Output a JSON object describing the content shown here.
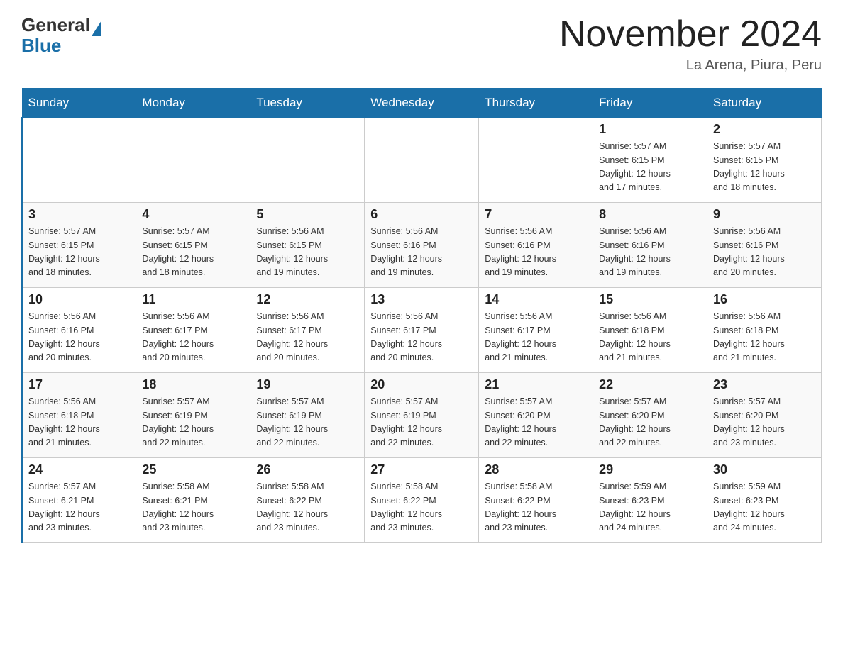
{
  "logo": {
    "text_general": "General",
    "text_blue": "Blue"
  },
  "title": "November 2024",
  "location": "La Arena, Piura, Peru",
  "weekdays": [
    "Sunday",
    "Monday",
    "Tuesday",
    "Wednesday",
    "Thursday",
    "Friday",
    "Saturday"
  ],
  "weeks": [
    [
      {
        "day": "",
        "info": ""
      },
      {
        "day": "",
        "info": ""
      },
      {
        "day": "",
        "info": ""
      },
      {
        "day": "",
        "info": ""
      },
      {
        "day": "",
        "info": ""
      },
      {
        "day": "1",
        "info": "Sunrise: 5:57 AM\nSunset: 6:15 PM\nDaylight: 12 hours\nand 17 minutes."
      },
      {
        "day": "2",
        "info": "Sunrise: 5:57 AM\nSunset: 6:15 PM\nDaylight: 12 hours\nand 18 minutes."
      }
    ],
    [
      {
        "day": "3",
        "info": "Sunrise: 5:57 AM\nSunset: 6:15 PM\nDaylight: 12 hours\nand 18 minutes."
      },
      {
        "day": "4",
        "info": "Sunrise: 5:57 AM\nSunset: 6:15 PM\nDaylight: 12 hours\nand 18 minutes."
      },
      {
        "day": "5",
        "info": "Sunrise: 5:56 AM\nSunset: 6:15 PM\nDaylight: 12 hours\nand 19 minutes."
      },
      {
        "day": "6",
        "info": "Sunrise: 5:56 AM\nSunset: 6:16 PM\nDaylight: 12 hours\nand 19 minutes."
      },
      {
        "day": "7",
        "info": "Sunrise: 5:56 AM\nSunset: 6:16 PM\nDaylight: 12 hours\nand 19 minutes."
      },
      {
        "day": "8",
        "info": "Sunrise: 5:56 AM\nSunset: 6:16 PM\nDaylight: 12 hours\nand 19 minutes."
      },
      {
        "day": "9",
        "info": "Sunrise: 5:56 AM\nSunset: 6:16 PM\nDaylight: 12 hours\nand 20 minutes."
      }
    ],
    [
      {
        "day": "10",
        "info": "Sunrise: 5:56 AM\nSunset: 6:16 PM\nDaylight: 12 hours\nand 20 minutes."
      },
      {
        "day": "11",
        "info": "Sunrise: 5:56 AM\nSunset: 6:17 PM\nDaylight: 12 hours\nand 20 minutes."
      },
      {
        "day": "12",
        "info": "Sunrise: 5:56 AM\nSunset: 6:17 PM\nDaylight: 12 hours\nand 20 minutes."
      },
      {
        "day": "13",
        "info": "Sunrise: 5:56 AM\nSunset: 6:17 PM\nDaylight: 12 hours\nand 20 minutes."
      },
      {
        "day": "14",
        "info": "Sunrise: 5:56 AM\nSunset: 6:17 PM\nDaylight: 12 hours\nand 21 minutes."
      },
      {
        "day": "15",
        "info": "Sunrise: 5:56 AM\nSunset: 6:18 PM\nDaylight: 12 hours\nand 21 minutes."
      },
      {
        "day": "16",
        "info": "Sunrise: 5:56 AM\nSunset: 6:18 PM\nDaylight: 12 hours\nand 21 minutes."
      }
    ],
    [
      {
        "day": "17",
        "info": "Sunrise: 5:56 AM\nSunset: 6:18 PM\nDaylight: 12 hours\nand 21 minutes."
      },
      {
        "day": "18",
        "info": "Sunrise: 5:57 AM\nSunset: 6:19 PM\nDaylight: 12 hours\nand 22 minutes."
      },
      {
        "day": "19",
        "info": "Sunrise: 5:57 AM\nSunset: 6:19 PM\nDaylight: 12 hours\nand 22 minutes."
      },
      {
        "day": "20",
        "info": "Sunrise: 5:57 AM\nSunset: 6:19 PM\nDaylight: 12 hours\nand 22 minutes."
      },
      {
        "day": "21",
        "info": "Sunrise: 5:57 AM\nSunset: 6:20 PM\nDaylight: 12 hours\nand 22 minutes."
      },
      {
        "day": "22",
        "info": "Sunrise: 5:57 AM\nSunset: 6:20 PM\nDaylight: 12 hours\nand 22 minutes."
      },
      {
        "day": "23",
        "info": "Sunrise: 5:57 AM\nSunset: 6:20 PM\nDaylight: 12 hours\nand 23 minutes."
      }
    ],
    [
      {
        "day": "24",
        "info": "Sunrise: 5:57 AM\nSunset: 6:21 PM\nDaylight: 12 hours\nand 23 minutes."
      },
      {
        "day": "25",
        "info": "Sunrise: 5:58 AM\nSunset: 6:21 PM\nDaylight: 12 hours\nand 23 minutes."
      },
      {
        "day": "26",
        "info": "Sunrise: 5:58 AM\nSunset: 6:22 PM\nDaylight: 12 hours\nand 23 minutes."
      },
      {
        "day": "27",
        "info": "Sunrise: 5:58 AM\nSunset: 6:22 PM\nDaylight: 12 hours\nand 23 minutes."
      },
      {
        "day": "28",
        "info": "Sunrise: 5:58 AM\nSunset: 6:22 PM\nDaylight: 12 hours\nand 23 minutes."
      },
      {
        "day": "29",
        "info": "Sunrise: 5:59 AM\nSunset: 6:23 PM\nDaylight: 12 hours\nand 24 minutes."
      },
      {
        "day": "30",
        "info": "Sunrise: 5:59 AM\nSunset: 6:23 PM\nDaylight: 12 hours\nand 24 minutes."
      }
    ]
  ]
}
